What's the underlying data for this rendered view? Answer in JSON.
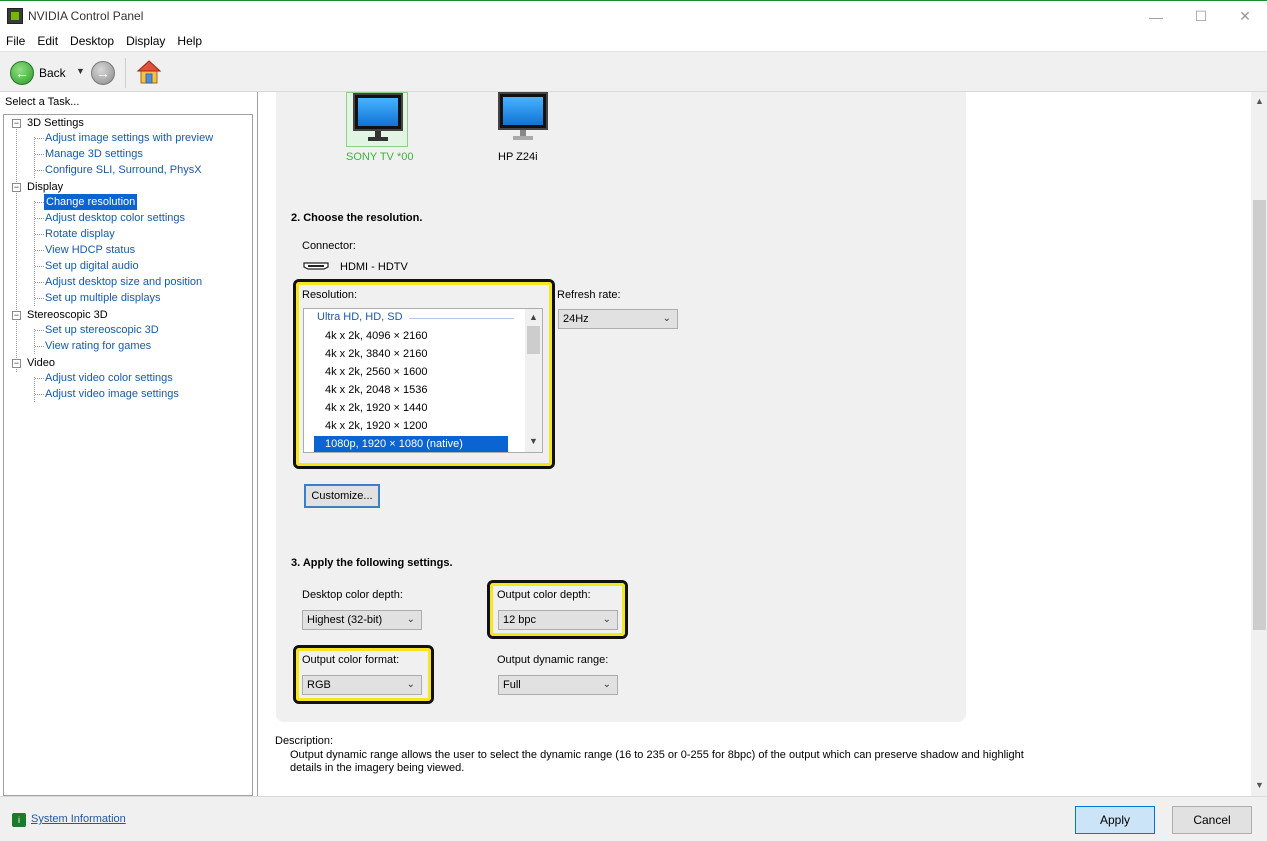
{
  "window": {
    "title": "NVIDIA Control Panel",
    "minimize_glyph": "—",
    "maximize_glyph": "☐",
    "close_glyph": "✕"
  },
  "menu": [
    "File",
    "Edit",
    "Desktop",
    "Display",
    "Help"
  ],
  "toolbar": {
    "back_label": "Back",
    "back_glyph": "←",
    "forward_glyph": "→",
    "caret_glyph": "▼"
  },
  "sidebar": {
    "header": "Select a Task...",
    "categories": [
      {
        "label": "3D Settings",
        "items": [
          "Adjust image settings with preview",
          "Manage 3D settings",
          "Configure SLI, Surround, PhysX"
        ]
      },
      {
        "label": "Display",
        "items": [
          "Change resolution",
          "Adjust desktop color settings",
          "Rotate display",
          "View HDCP status",
          "Set up digital audio",
          "Adjust desktop size and position",
          "Set up multiple displays"
        ]
      },
      {
        "label": "Stereoscopic 3D",
        "items": [
          "Set up stereoscopic 3D",
          "View rating for games"
        ]
      },
      {
        "label": "Video",
        "items": [
          "Adjust video color settings",
          "Adjust video image settings"
        ]
      }
    ],
    "selected_item": "Change resolution",
    "expander_glyph": "−"
  },
  "displays": [
    {
      "name": "SONY TV  *00",
      "selected": true
    },
    {
      "name": "HP Z24i",
      "selected": false
    }
  ],
  "resolution_section": {
    "title": "2. Choose the resolution.",
    "connector_label": "Connector:",
    "connector_value": "HDMI - HDTV",
    "resolution_label": "Resolution:",
    "group_label": "Ultra HD, HD, SD",
    "items": [
      "4k x 2k, 4096 × 2160",
      "4k x 2k, 3840 × 2160",
      "4k x 2k, 2560 × 1600",
      "4k x 2k, 2048 × 1536",
      "4k x 2k, 1920 × 1440",
      "4k x 2k, 1920 × 1200",
      "1080p, 1920 × 1080 (native)"
    ],
    "selected_index": 6,
    "refresh_label": "Refresh rate:",
    "refresh_value": "24Hz",
    "customize_label": "Customize..."
  },
  "apply_section": {
    "title": "3. Apply the following settings.",
    "desktop_depth_label": "Desktop color depth:",
    "desktop_depth_value": "Highest (32-bit)",
    "output_depth_label": "Output color depth:",
    "output_depth_value": "12 bpc",
    "output_format_label": "Output color format:",
    "output_format_value": "RGB",
    "dynamic_range_label": "Output dynamic range:",
    "dynamic_range_value": "Full"
  },
  "description": {
    "label": "Description:",
    "text": "Output dynamic range allows the user to select the dynamic range (16 to 235 or 0-255 for 8bpc) of the output which can preserve shadow and highlight details in the imagery being viewed."
  },
  "footer": {
    "system_info": "System Information",
    "apply": "Apply",
    "cancel": "Cancel"
  },
  "glyphs": {
    "combo_caret": "⌄",
    "scroll_up": "▲",
    "scroll_down": "▼"
  },
  "colors": {
    "highlight_yellow": "#f5e61e",
    "selection_blue": "#0a64d2",
    "link_blue": "#1a5aa7",
    "nvidia_green": "#76b900"
  }
}
